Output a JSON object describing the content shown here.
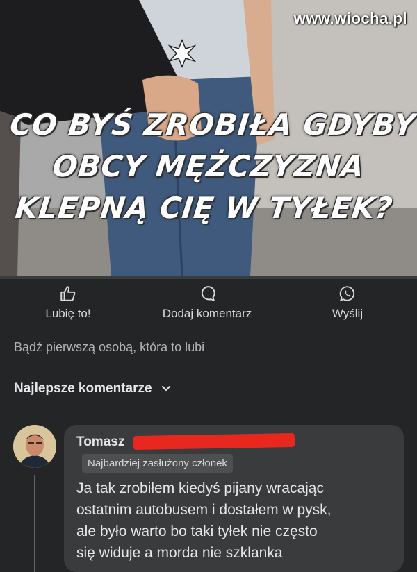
{
  "meme": {
    "watermark": "www.wiocha.pl",
    "caption_lines": [
      "CO BYŚ ZROBIŁA GDYBY",
      "OBCY MĘŻCZYZNA",
      "KLEPNĄ CIĘ W TYŁEK?"
    ]
  },
  "actions": {
    "like": "Lubię to!",
    "comment": "Dodaj komentarz",
    "send": "Wyślij"
  },
  "likes_text": "Bądź pierwszą osobą, która to lubi",
  "comments_filter": "Najlepsze komentarze",
  "comment": {
    "author": "Tomasz",
    "badge": "Najbardziej zasłużony członek",
    "text_lines": [
      "Ja tak zrobiłem kiedyś pijany wracając",
      "ostatnim autobusem i dostałem w pysk,",
      "ale było warto bo taki tyłek nie często",
      "się widuje a morda nie szklanka"
    ]
  },
  "colors": {
    "background": "#242526",
    "bubble": "#3a3b3c",
    "redaction": "#e8271f"
  },
  "icons": [
    "thumbs-up-icon",
    "comment-icon",
    "whatsapp-icon",
    "chevron-down-icon"
  ]
}
